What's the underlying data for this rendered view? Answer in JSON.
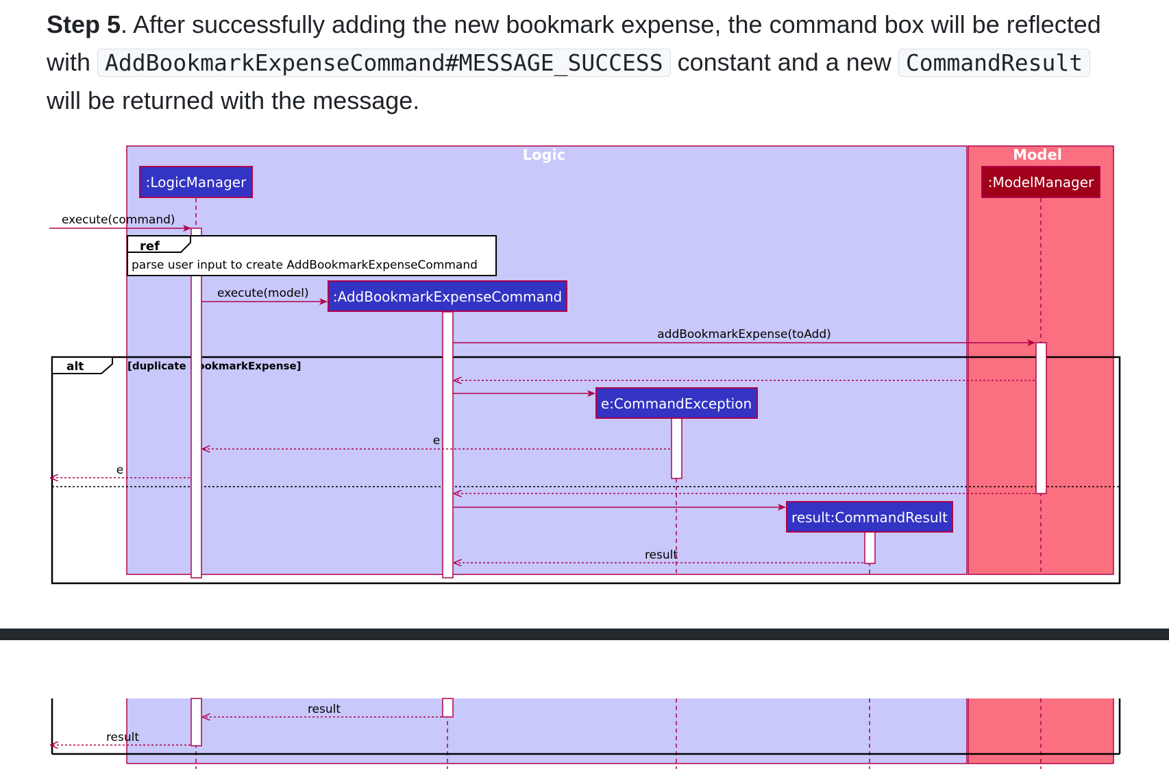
{
  "step": {
    "label": "Step 5",
    "text_1": ". After successfully adding the new bookmark expense, the command box will be reflected with ",
    "code_1": "AddBookmarkExpenseCommand#MESSAGE_SUCCESS",
    "text_2": " constant and a new ",
    "code_2": "CommandResult",
    "text_3": " will be returned with the message."
  },
  "diagram": {
    "box_logic": "Logic",
    "box_model": "Model",
    "participant_logic_manager": ":LogicManager",
    "participant_model_manager": ":ModelManager",
    "participant_add_command": ":AddBookmarkExpenseCommand",
    "participant_command_exception": "e:CommandException",
    "participant_command_result": "result:CommandResult",
    "msg_execute_command": "execute(command)",
    "ref_tag": "ref",
    "ref_text": "parse user input to create AddBookmarkExpenseCommand",
    "msg_execute_model": "execute(model)",
    "msg_add_bookmark_expense": "addBookmarkExpense(toAdd)",
    "alt_tag": "alt",
    "alt_guard": "[duplicate BookmarkExpense]",
    "msg_return_e_1": "e",
    "msg_return_e_2": "e",
    "msg_return_result_1": "result",
    "msg_return_result_2": "result",
    "msg_return_result_3": "result"
  },
  "colors": {
    "logic_box": "#c8c8fa",
    "model_box": "#fa7080",
    "participant_blue": "#3333c4",
    "participant_red": "#a0001a",
    "arrow": "#b0004a",
    "divider": "#24292e"
  }
}
